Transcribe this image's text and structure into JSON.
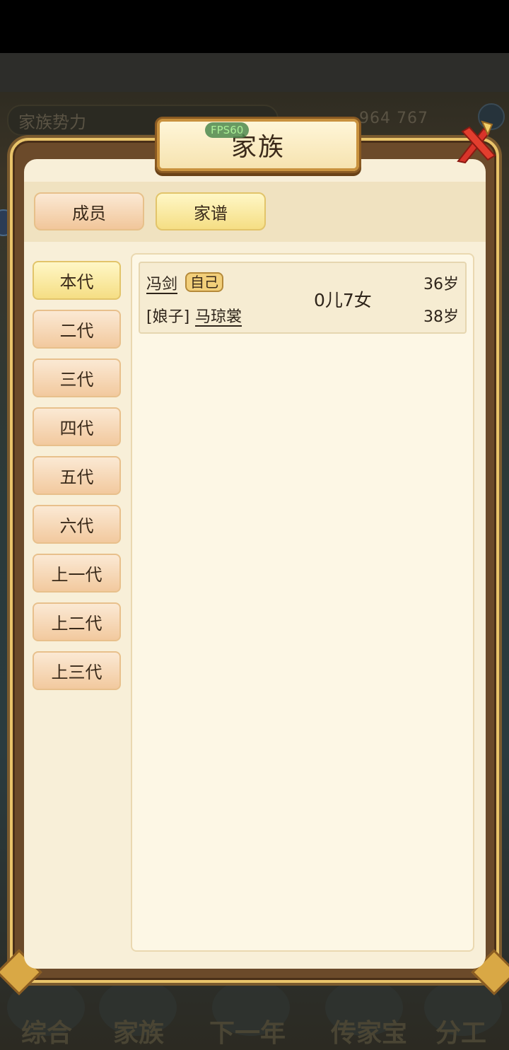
{
  "background": {
    "power_label": "家族势力",
    "resources": "964  767",
    "bottom_tabs": [
      "综合",
      "家族",
      "下一年",
      "传家宝",
      "分工"
    ]
  },
  "dialog": {
    "title": "家族",
    "fps_badge": "FPS60",
    "top_tabs": [
      {
        "label": "成员",
        "active": false
      },
      {
        "label": "家谱",
        "active": true
      }
    ],
    "generations": [
      {
        "label": "本代",
        "active": true
      },
      {
        "label": "二代",
        "active": false
      },
      {
        "label": "三代",
        "active": false
      },
      {
        "label": "四代",
        "active": false
      },
      {
        "label": "五代",
        "active": false
      },
      {
        "label": "六代",
        "active": false
      },
      {
        "label": "上一代",
        "active": false
      },
      {
        "label": "上二代",
        "active": false
      },
      {
        "label": "上三代",
        "active": false
      }
    ],
    "family_card": {
      "member_name": "冯剑",
      "self_tag": "自己",
      "member_age": "36岁",
      "spouse_prefix": "[娘子]",
      "spouse_name": "马琼裳",
      "spouse_age": "38岁",
      "children": "0儿7女"
    }
  },
  "colors": {
    "panel": "#f8efd8",
    "frame_gold": "#e9c46a",
    "tab_active": "#f5de84",
    "tab_inactive": "#f2c99e"
  }
}
